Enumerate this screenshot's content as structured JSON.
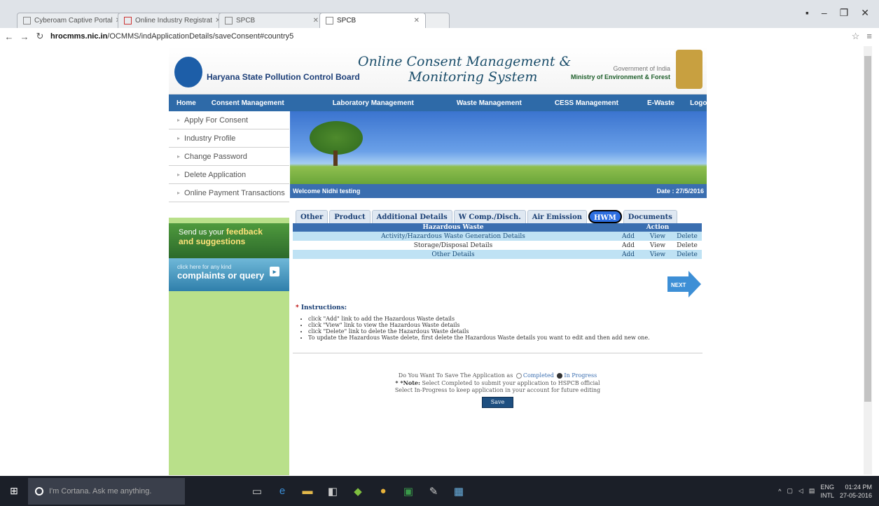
{
  "browser": {
    "tabs": [
      {
        "label": "Cyberoam Captive Portal",
        "active": false
      },
      {
        "label": "Online Industry Registrat",
        "active": false
      },
      {
        "label": "SPCB",
        "active": false
      },
      {
        "label": "SPCB",
        "active": true
      }
    ],
    "url_host": "hrocmms.nic.in",
    "url_path": "/OCMMS/indApplicationDetails/saveConsent#country5"
  },
  "header": {
    "board_name": "Haryana State Pollution Control Board",
    "title_line1": "Online Consent Management &",
    "title_line2": "Monitoring System",
    "goi": "Government of India",
    "ministry": "Ministry of Environment & Forest"
  },
  "nav": [
    "Home",
    "Consent Management",
    "Laboratory Management",
    "Waste Management",
    "CESS Management",
    "E-Waste",
    "Logout"
  ],
  "sidebar": {
    "items": [
      "Apply For Consent",
      "Industry Profile",
      "Change Password",
      "Delete Application",
      "Online Payment Transactions"
    ],
    "feedback_line1": "Send us your",
    "feedback_bold1": "feedback",
    "feedback_line2": "and suggestions",
    "complaints_small": "click here for any kind",
    "complaints_big": "complaints or query"
  },
  "welcome": {
    "text": "Welcome Nidhi testing",
    "date": "Date : 27/5/2016"
  },
  "form_tabs": [
    "Other",
    "Product",
    "Additional Details",
    "W Comp./Disch.",
    "Air Emission",
    "HWM",
    "Documents"
  ],
  "hw_table": {
    "header_left": "Hazardous Waste",
    "header_right": "Action",
    "rows": [
      {
        "name": "Activity/Hazardous Waste Generation Details",
        "add": "Add",
        "view": "View",
        "delete": "Delete"
      },
      {
        "name": "Storage/Disposal Details",
        "add": "Add",
        "view": "View",
        "delete": "Delete"
      },
      {
        "name": "Other Details",
        "add": "Add",
        "view": "View",
        "delete": "Delete"
      }
    ]
  },
  "next_label": "NEXT",
  "instructions": {
    "heading": "Instructions:",
    "items": [
      "click \"Add\" link to add the Hazardous Waste details",
      "click \"View\" link to view the Hazardous Waste details",
      "click \"Delete\" link to delete the Hazardous Waste details",
      "To update the Hazardous Waste delete, first delete the Hazardous Waste details you want to edit and then add new one."
    ]
  },
  "save_section": {
    "question": "Do You Want To Save The Application as",
    "opt_completed": "Completed",
    "opt_progress": "In Progress",
    "note_label": "* *Note:",
    "note_text": "Select Completed to submit your application to HSPCB official",
    "note_line2": "Select In-Progress to keep application in your account for future editing",
    "save_label": "Save"
  },
  "taskbar": {
    "cortana": "I'm Cortana. Ask me anything.",
    "lang1": "ENG",
    "lang2": "INTL",
    "time": "01:24 PM",
    "date": "27-05-2016"
  }
}
